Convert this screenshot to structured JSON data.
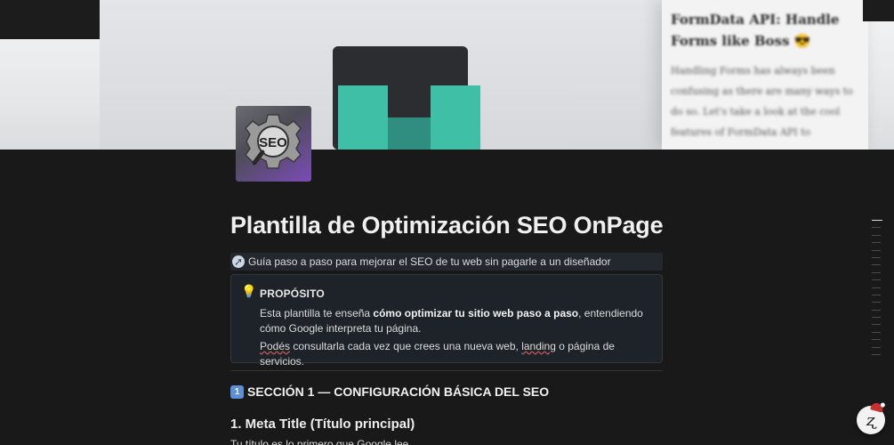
{
  "cover": {
    "card_title": "FormData API: Handle Forms like Boss 😎",
    "card_text": "Handling Forms has always been confusing as there are many ways to do so. Let's take a look at the cool features of FormData API to"
  },
  "page": {
    "icon_name": "seo-gear-icon",
    "icon_text": "SEO",
    "title": "Plantilla de Optimización SEO OnPage",
    "subtitle": "Guía paso a paso para mejorar el SEO de tu web sin pagarle a un diseñador"
  },
  "callout": {
    "label": "PROPÓSITO",
    "line1_pre": "Esta plantilla te enseña ",
    "line1_bold": "cómo optimizar tu sitio web paso a paso",
    "line1_post": ", entendiendo cómo Google interpreta tu página.",
    "line2_w1": "Podés",
    "line2_a": " consultarla cada vez que crees una nueva web, ",
    "line2_w2": "landing",
    "line2_b": " o página de servicios."
  },
  "section": {
    "number": "1",
    "heading": "SECCIÓN 1 — CONFIGURACIÓN BÁSICA DEL SEO",
    "subheading": "1. Meta Title (Título principal)",
    "paragraph": "Tu título es lo primero que Google lee."
  },
  "colors": {
    "background": "#191919",
    "callout_bg": "#1d2328",
    "subtitle_bg": "#23272e",
    "teal": "#3fbfa6",
    "section_badge": "#5b8fd8"
  }
}
